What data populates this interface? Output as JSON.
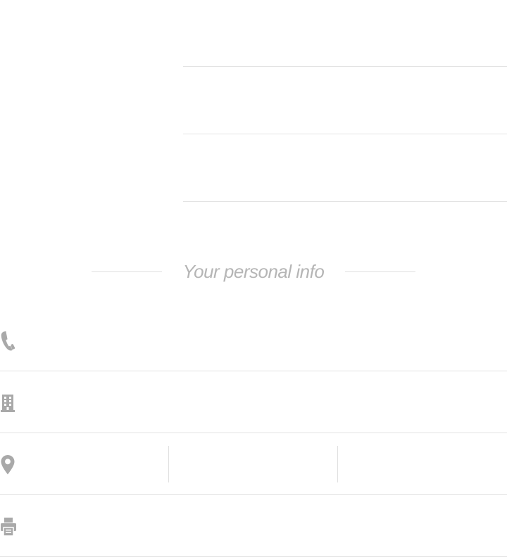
{
  "form": {
    "top_fields": [
      {
        "value": "",
        "placeholder": ""
      },
      {
        "value": "",
        "placeholder": ""
      },
      {
        "value": "",
        "placeholder": ""
      }
    ]
  },
  "personal_info": {
    "section_title": "Your personal info",
    "icon_color": "#a9a9a9",
    "rows": {
      "phone": {
        "icon": "phone-icon",
        "value": "",
        "placeholder": ""
      },
      "company": {
        "icon": "building-icon",
        "value": "",
        "placeholder": ""
      },
      "location": {
        "icon": "map-pin-icon",
        "fields": [
          {
            "value": "",
            "placeholder": ""
          },
          {
            "value": "",
            "placeholder": ""
          },
          {
            "value": "",
            "placeholder": ""
          }
        ]
      },
      "fax": {
        "icon": "printer-icon",
        "value": "",
        "placeholder": ""
      }
    }
  }
}
